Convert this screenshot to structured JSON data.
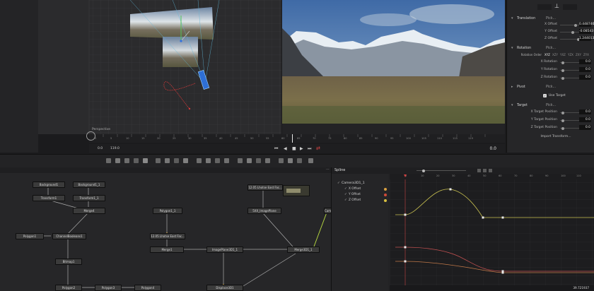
{
  "viewer": {
    "left_label": "Perspective",
    "time_start": "0.0",
    "time_end": "119.0",
    "time_current": "0.0",
    "ruler_ticks": [
      "0",
      "5",
      "10",
      "15",
      "20",
      "25",
      "30",
      "35",
      "40",
      "45",
      "50",
      "55",
      "60",
      "65",
      "70",
      "75",
      "80",
      "85",
      "90",
      "95",
      "100",
      "105",
      "110",
      "115",
      "119"
    ]
  },
  "inspector": {
    "translation": {
      "title": "Translation",
      "pick": "Pick...",
      "rows": [
        {
          "label": "X Offset",
          "value": "0.448746"
        },
        {
          "label": "Y Offset",
          "value": "-0.08543"
        },
        {
          "label": "Z Offset",
          "value": "1.244013"
        }
      ]
    },
    "rotation": {
      "title": "Rotation",
      "pick": "Pick...",
      "order_label": "Rotation Order",
      "order_options": [
        "XYZ",
        "XZY",
        "YXZ",
        "YZX",
        "ZXY",
        "ZYX"
      ],
      "rows": [
        {
          "label": "X Rotation",
          "value": "0.0"
        },
        {
          "label": "Y Rotation",
          "value": "0.0"
        },
        {
          "label": "Z Rotation",
          "value": "0.0"
        }
      ]
    },
    "pivot": {
      "title": "Pivot",
      "pick": "Pick..."
    },
    "use_target_label": "Use Target",
    "target": {
      "title": "Target",
      "pick": "Pick...",
      "rows": [
        {
          "label": "X Target Position",
          "value": "0.0"
        },
        {
          "label": "Y Target Position",
          "value": "0.0"
        },
        {
          "label": "Z Target Position",
          "value": "0.0"
        }
      ]
    },
    "import_button": "Import Transform..."
  },
  "nodes": {
    "background1": "Background1",
    "background1_1": "Background1_1",
    "transform1": "Transform1",
    "transform1_1": "Transform1_1",
    "merge4": "Merge4",
    "polygon1": "Polygon1",
    "channel_booleans": "ChannelBooleans1",
    "bitmap1": "Bitmap1",
    "polygon2": "Polygon2",
    "polygon3": "Polygon3",
    "polygon4": "Polygon4",
    "polygon1_1": "Polygon1_1",
    "media1": "12.05 Lhotse East Fac...",
    "media2": "12.05 Lhotse East Fac...",
    "merge1": "Merge1",
    "image_plane": "ImagePlane3D1_1",
    "shape_image_plane": "5XX_ImagePlane",
    "merge3d": "Merge3D1_1",
    "displace": "Displace3D1",
    "camera_stub": "Cam"
  },
  "spline": {
    "title": "Spline",
    "tree_root": "Camera3D1_1",
    "channels": [
      {
        "name": "X Offset",
        "color": "#c8c050"
      },
      {
        "name": "Y Offset",
        "color": "#c05050"
      },
      {
        "name": "Z Offset",
        "color": "#c07848"
      }
    ],
    "ruler": [
      "0",
      "10",
      "20",
      "30",
      "40",
      "50",
      "60",
      "70",
      "80",
      "90",
      "100",
      "110"
    ],
    "bottom_value": "39.721937"
  }
}
